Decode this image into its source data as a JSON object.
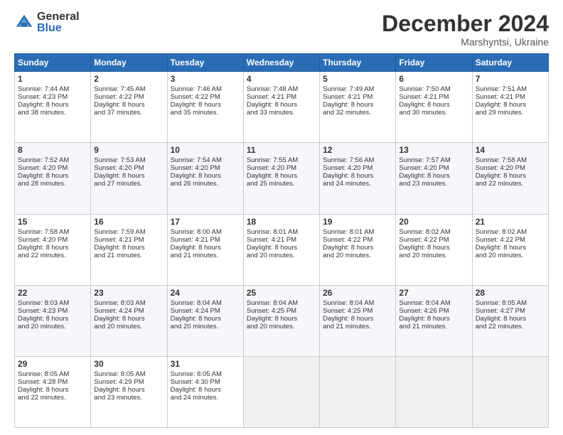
{
  "logo": {
    "general": "General",
    "blue": "Blue"
  },
  "header": {
    "month": "December 2024",
    "location": "Marshyntsi, Ukraine"
  },
  "days_of_week": [
    "Sunday",
    "Monday",
    "Tuesday",
    "Wednesday",
    "Thursday",
    "Friday",
    "Saturday"
  ],
  "weeks": [
    [
      {
        "day": "1",
        "lines": [
          "Sunrise: 7:44 AM",
          "Sunset: 4:23 PM",
          "Daylight: 8 hours",
          "and 38 minutes."
        ]
      },
      {
        "day": "2",
        "lines": [
          "Sunrise: 7:45 AM",
          "Sunset: 4:22 PM",
          "Daylight: 8 hours",
          "and 37 minutes."
        ]
      },
      {
        "day": "3",
        "lines": [
          "Sunrise: 7:46 AM",
          "Sunset: 4:22 PM",
          "Daylight: 8 hours",
          "and 35 minutes."
        ]
      },
      {
        "day": "4",
        "lines": [
          "Sunrise: 7:48 AM",
          "Sunset: 4:21 PM",
          "Daylight: 8 hours",
          "and 33 minutes."
        ]
      },
      {
        "day": "5",
        "lines": [
          "Sunrise: 7:49 AM",
          "Sunset: 4:21 PM",
          "Daylight: 8 hours",
          "and 32 minutes."
        ]
      },
      {
        "day": "6",
        "lines": [
          "Sunrise: 7:50 AM",
          "Sunset: 4:21 PM",
          "Daylight: 8 hours",
          "and 30 minutes."
        ]
      },
      {
        "day": "7",
        "lines": [
          "Sunrise: 7:51 AM",
          "Sunset: 4:21 PM",
          "Daylight: 8 hours",
          "and 29 minutes."
        ]
      }
    ],
    [
      {
        "day": "8",
        "lines": [
          "Sunrise: 7:52 AM",
          "Sunset: 4:20 PM",
          "Daylight: 8 hours",
          "and 28 minutes."
        ]
      },
      {
        "day": "9",
        "lines": [
          "Sunrise: 7:53 AM",
          "Sunset: 4:20 PM",
          "Daylight: 8 hours",
          "and 27 minutes."
        ]
      },
      {
        "day": "10",
        "lines": [
          "Sunrise: 7:54 AM",
          "Sunset: 4:20 PM",
          "Daylight: 8 hours",
          "and 26 minutes."
        ]
      },
      {
        "day": "11",
        "lines": [
          "Sunrise: 7:55 AM",
          "Sunset: 4:20 PM",
          "Daylight: 8 hours",
          "and 25 minutes."
        ]
      },
      {
        "day": "12",
        "lines": [
          "Sunrise: 7:56 AM",
          "Sunset: 4:20 PM",
          "Daylight: 8 hours",
          "and 24 minutes."
        ]
      },
      {
        "day": "13",
        "lines": [
          "Sunrise: 7:57 AM",
          "Sunset: 4:20 PM",
          "Daylight: 8 hours",
          "and 23 minutes."
        ]
      },
      {
        "day": "14",
        "lines": [
          "Sunrise: 7:58 AM",
          "Sunset: 4:20 PM",
          "Daylight: 8 hours",
          "and 22 minutes."
        ]
      }
    ],
    [
      {
        "day": "15",
        "lines": [
          "Sunrise: 7:58 AM",
          "Sunset: 4:20 PM",
          "Daylight: 8 hours",
          "and 22 minutes."
        ]
      },
      {
        "day": "16",
        "lines": [
          "Sunrise: 7:59 AM",
          "Sunset: 4:21 PM",
          "Daylight: 8 hours",
          "and 21 minutes."
        ]
      },
      {
        "day": "17",
        "lines": [
          "Sunrise: 8:00 AM",
          "Sunset: 4:21 PM",
          "Daylight: 8 hours",
          "and 21 minutes."
        ]
      },
      {
        "day": "18",
        "lines": [
          "Sunrise: 8:01 AM",
          "Sunset: 4:21 PM",
          "Daylight: 8 hours",
          "and 20 minutes."
        ]
      },
      {
        "day": "19",
        "lines": [
          "Sunrise: 8:01 AM",
          "Sunset: 4:22 PM",
          "Daylight: 8 hours",
          "and 20 minutes."
        ]
      },
      {
        "day": "20",
        "lines": [
          "Sunrise: 8:02 AM",
          "Sunset: 4:22 PM",
          "Daylight: 8 hours",
          "and 20 minutes."
        ]
      },
      {
        "day": "21",
        "lines": [
          "Sunrise: 8:02 AM",
          "Sunset: 4:22 PM",
          "Daylight: 8 hours",
          "and 20 minutes."
        ]
      }
    ],
    [
      {
        "day": "22",
        "lines": [
          "Sunrise: 8:03 AM",
          "Sunset: 4:23 PM",
          "Daylight: 8 hours",
          "and 20 minutes."
        ]
      },
      {
        "day": "23",
        "lines": [
          "Sunrise: 8:03 AM",
          "Sunset: 4:24 PM",
          "Daylight: 8 hours",
          "and 20 minutes."
        ]
      },
      {
        "day": "24",
        "lines": [
          "Sunrise: 8:04 AM",
          "Sunset: 4:24 PM",
          "Daylight: 8 hours",
          "and 20 minutes."
        ]
      },
      {
        "day": "25",
        "lines": [
          "Sunrise: 8:04 AM",
          "Sunset: 4:25 PM",
          "Daylight: 8 hours",
          "and 20 minutes."
        ]
      },
      {
        "day": "26",
        "lines": [
          "Sunrise: 8:04 AM",
          "Sunset: 4:25 PM",
          "Daylight: 8 hours",
          "and 21 minutes."
        ]
      },
      {
        "day": "27",
        "lines": [
          "Sunrise: 8:04 AM",
          "Sunset: 4:26 PM",
          "Daylight: 8 hours",
          "and 21 minutes."
        ]
      },
      {
        "day": "28",
        "lines": [
          "Sunrise: 8:05 AM",
          "Sunset: 4:27 PM",
          "Daylight: 8 hours",
          "and 22 minutes."
        ]
      }
    ],
    [
      {
        "day": "29",
        "lines": [
          "Sunrise: 8:05 AM",
          "Sunset: 4:28 PM",
          "Daylight: 8 hours",
          "and 22 minutes."
        ]
      },
      {
        "day": "30",
        "lines": [
          "Sunrise: 8:05 AM",
          "Sunset: 4:29 PM",
          "Daylight: 8 hours",
          "and 23 minutes."
        ]
      },
      {
        "day": "31",
        "lines": [
          "Sunrise: 8:05 AM",
          "Sunset: 4:30 PM",
          "Daylight: 8 hours",
          "and 24 minutes."
        ]
      },
      null,
      null,
      null,
      null
    ]
  ]
}
